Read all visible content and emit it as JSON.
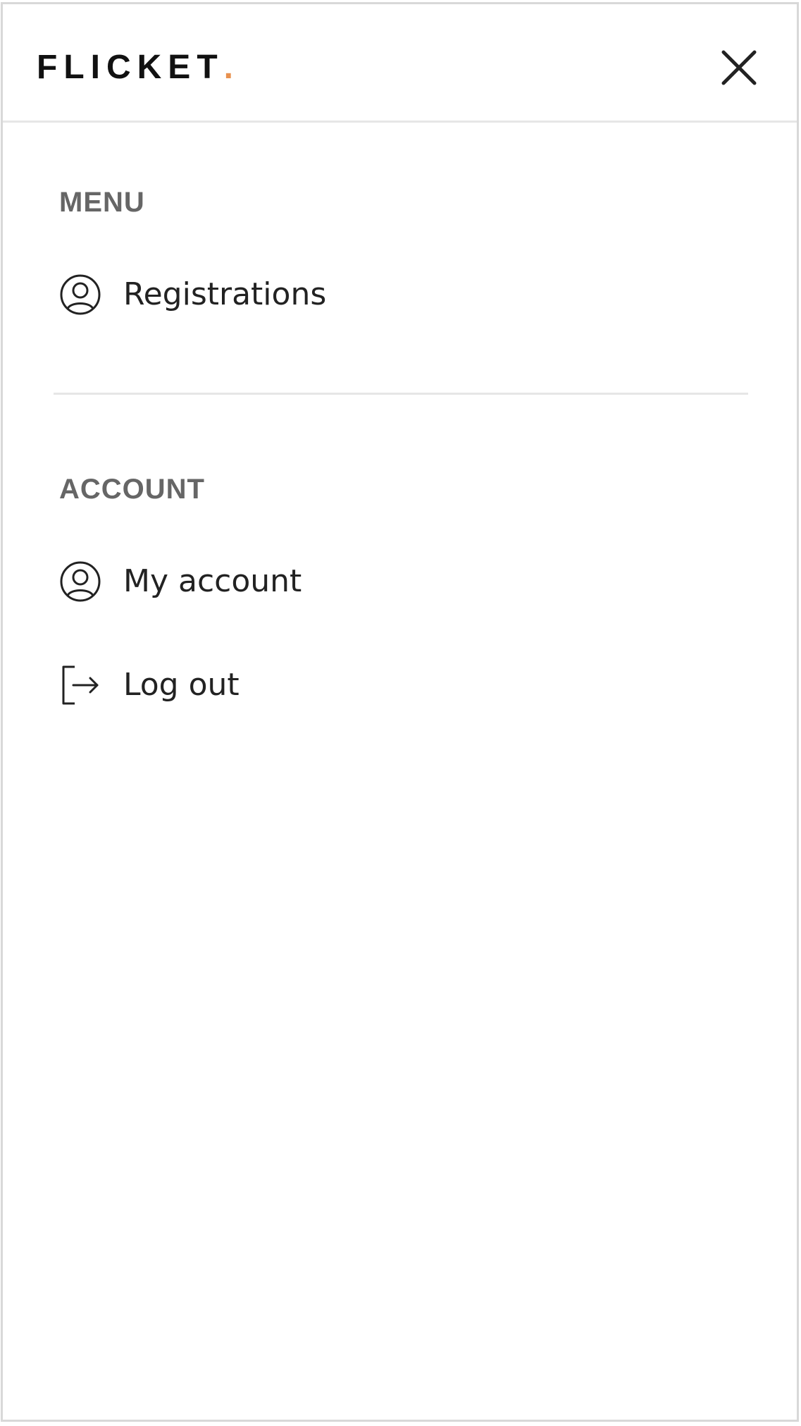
{
  "header": {
    "logo_text": "FLICKET",
    "logo_dot": ".",
    "close_icon": "close-icon"
  },
  "menu": {
    "title": "MENU",
    "items": [
      {
        "label": "Registrations",
        "icon": "user-circle-icon"
      }
    ]
  },
  "account": {
    "title": "ACCOUNT",
    "items": [
      {
        "label": "My account",
        "icon": "user-circle-icon"
      },
      {
        "label": "Log out",
        "icon": "logout-icon"
      }
    ]
  },
  "colors": {
    "accent": "#e8914f",
    "text": "#222222",
    "section_title": "#666666",
    "divider": "#e6e6e6"
  }
}
